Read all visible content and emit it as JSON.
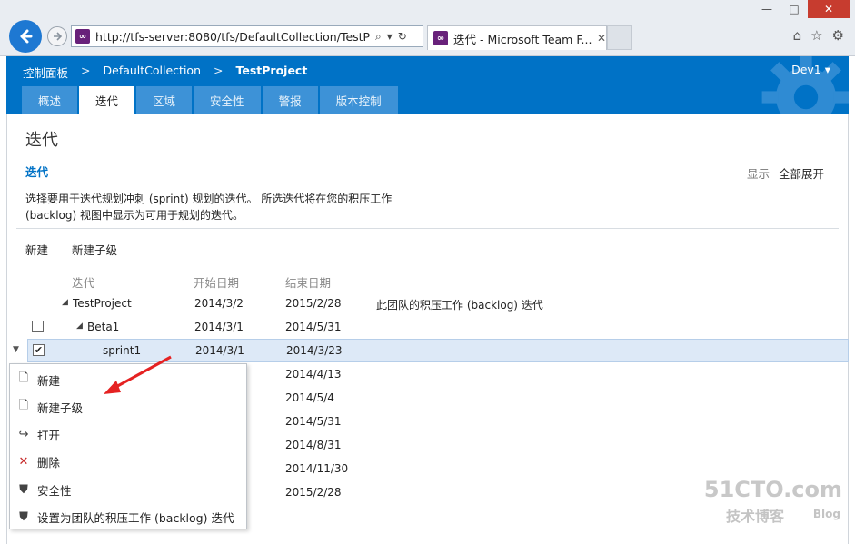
{
  "browser": {
    "url": "http://tfs-server:8080/tfs/DefaultCollection/TestProjec",
    "tab_title": "迭代 - Microsoft Team F...",
    "minimize": "—",
    "maximize": "□",
    "close": "✕"
  },
  "header": {
    "breadcrumb": [
      "控制面板",
      "DefaultCollection",
      "TestProject"
    ],
    "breadcrumb_sep": ">",
    "user": "Dev1 ▾",
    "tabs": [
      "概述",
      "迭代",
      "区域",
      "安全性",
      "警报",
      "版本控制"
    ],
    "active_tab": 1,
    "colors": {
      "brand": "#0072c6",
      "tab_inactive": "#3d92d7"
    }
  },
  "page": {
    "title": "迭代",
    "section_title": "迭代",
    "show_label": "显示",
    "show_value": "全部展开",
    "description_line1": "选择要用于迭代规划冲刺 (sprint) 规划的迭代。 所选迭代将在您的积压工作",
    "description_line2": "(backlog) 视图中显示为可用于规划的迭代。"
  },
  "toolbar": {
    "new_label": "新建",
    "new_child_label": "新建子级"
  },
  "grid": {
    "columns": [
      "迭代",
      "开始日期",
      "结束日期"
    ],
    "rows": [
      {
        "name": "TestProject",
        "start": "2014/3/2",
        "end": "2015/2/28",
        "note": "此团队的积压工作 (backlog) 迭代"
      },
      {
        "name": "Beta1",
        "start": "2014/3/1",
        "end": "2014/5/31",
        "note": ""
      },
      {
        "name": "sprint1",
        "start": "2014/3/1",
        "end": "2014/3/23",
        "note": ""
      },
      {
        "name": "",
        "start": "",
        "end": "2014/4/13",
        "note": ""
      },
      {
        "name": "",
        "start": "",
        "end": "2014/5/4",
        "note": ""
      },
      {
        "name": "",
        "start": "",
        "end": "2014/5/31",
        "note": ""
      },
      {
        "name": "",
        "start": "",
        "end": "2014/8/31",
        "note": ""
      },
      {
        "name": "",
        "start": "",
        "end": "2014/11/30",
        "note": ""
      },
      {
        "name": "",
        "start": "",
        "end": "2015/2/28",
        "note": ""
      }
    ]
  },
  "context_menu": {
    "items": [
      "新建",
      "新建子级",
      "打开",
      "删除",
      "安全性",
      "设置为团队的积压工作 (backlog) 迭代"
    ]
  },
  "watermark": {
    "main": "51CTO.com",
    "sub": "技术博客",
    "blog": "Blog"
  }
}
